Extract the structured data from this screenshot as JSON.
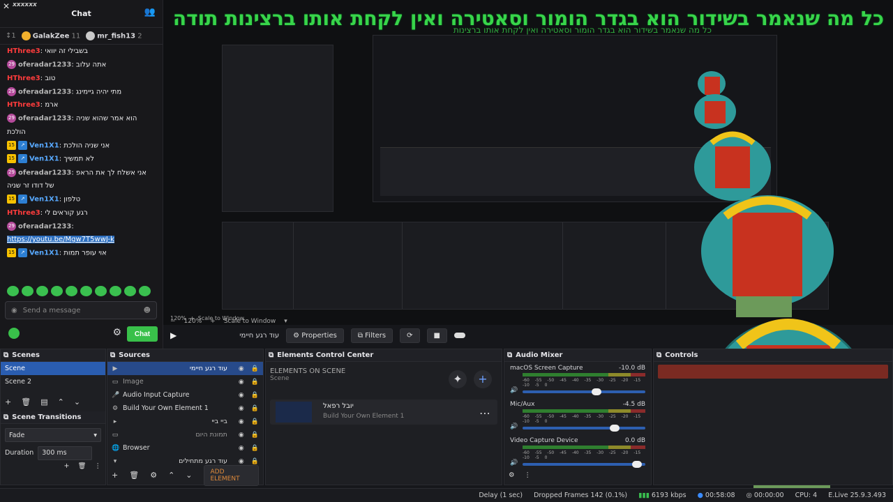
{
  "overlay": {
    "text": "כל מה שנאמר בשידור הוא בגדר הומור וסאטירה ואין לקחת אותו ברצינות תודה",
    "text_small": "כל מה שנאמר בשידור הוא בגדר הומור וסאטירה ואין לקחת אותו ברצינות"
  },
  "chat": {
    "title": "Chat",
    "window_title": "xxxxxx",
    "leader1": {
      "name": "GalakZee",
      "count": "11"
    },
    "leader2": {
      "name": "mr_fish13",
      "count": "2"
    },
    "messages": [
      {
        "badge": "",
        "user": "HThree3",
        "utype": "u1",
        "text": "בשבילי זה יוואי"
      },
      {
        "badge": "29",
        "user": "oferadar1233",
        "utype": "u2",
        "text": "אתה עלוב"
      },
      {
        "badge": "",
        "user": "HThree3",
        "utype": "u1",
        "text": "טוב"
      },
      {
        "badge": "29",
        "user": "oferadar1233",
        "utype": "u2",
        "text": "מתי יהיה גיימינג"
      },
      {
        "badge": "",
        "user": "HThree3",
        "utype": "u1",
        "text": "ארמ"
      },
      {
        "badge": "29",
        "user": "oferadar1233",
        "utype": "u2",
        "text": "הוא אמר שהוא שניה"
      },
      {
        "badge": "",
        "user": "",
        "utype": "u2",
        "text": "הולכת"
      },
      {
        "badge": "15",
        "user": "Ven1X1",
        "utype": "u3",
        "text": "אני שניה הולכת"
      },
      {
        "badge": "15",
        "user": "Ven1X1",
        "utype": "u3",
        "text": "לא תמשיך"
      },
      {
        "badge": "29",
        "user": "oferadar1233",
        "utype": "u2",
        "text": "אני אשלח לך את הראפ"
      },
      {
        "badge": "",
        "user": "",
        "utype": "u2",
        "text": "של דודו זר שניה"
      },
      {
        "badge": "15",
        "user": "Ven1X1",
        "utype": "u3",
        "text": "טלפון"
      },
      {
        "badge": "",
        "user": "HThree3",
        "utype": "u1",
        "text": "רגע קוראים לי"
      },
      {
        "badge": "29",
        "user": "oferadar1233",
        "utype": "u2",
        "text": ""
      },
      {
        "badge": "",
        "user": "",
        "utype": "link",
        "text": "https://youtu.be/Mgw7T5wwJ-k"
      },
      {
        "badge": "15",
        "user": "Ven1X1",
        "utype": "u3",
        "text": "אוי עופר תמות"
      }
    ],
    "send_placeholder": "Send a message",
    "chat_button": "Chat"
  },
  "preview": {
    "zoom": "120%",
    "scale_label": "Scale to Window",
    "scene_name_label": "עוד רגע חיימי",
    "properties": "Properties",
    "filters": "Filters"
  },
  "scenes": {
    "title": "Scenes",
    "items": [
      "Scene",
      "Scene 2"
    ]
  },
  "transitions": {
    "title": "Scene Transitions",
    "type": "Fade",
    "duration_label": "Duration",
    "duration": "300 ms"
  },
  "sources": {
    "title": "Sources",
    "items": [
      {
        "icon": "▶",
        "name": "עוד רגע חיימי",
        "rtl": true,
        "sel": true
      },
      {
        "icon": "▭",
        "name": "Image",
        "rtl": false,
        "dim": true
      },
      {
        "icon": "🎤",
        "name": "Audio Input Capture",
        "rtl": false
      },
      {
        "icon": "⚙",
        "name": "Build Your Own Element 1",
        "rtl": false
      },
      {
        "icon": "▸",
        "name": "ביי ביי",
        "rtl": true
      },
      {
        "icon": "▭",
        "name": "תמונת היום",
        "rtl": true,
        "dim": true
      },
      {
        "icon": "🌐",
        "name": "Browser",
        "rtl": false
      },
      {
        "icon": "▾",
        "name": "עוד רגע מתחילים",
        "rtl": true
      }
    ],
    "add_element": "ADD ELEMENT"
  },
  "elements": {
    "title": "Elements Control Center",
    "subtitle": "ELEMENTS ON SCENE",
    "scene": "Scene",
    "card_name": "יובל רפאל",
    "card_sub": "Build Your Own Element 1"
  },
  "mixer": {
    "title": "Audio Mixer",
    "channels": [
      {
        "name": "macOS Screen Capture",
        "db": "-10.0 dB",
        "level": 0.62
      },
      {
        "name": "Mic/Aux",
        "db": "-4.5 dB",
        "level": 0.77
      },
      {
        "name": "Video Capture Device",
        "db": "0.0 dB",
        "level": 0.95
      }
    ],
    "scale": "-60 -55 -50 -45 -40 -35 -30 -25 -20 -15 -10 -5 0"
  },
  "controls": {
    "title": "Controls"
  },
  "status": {
    "delay": "Delay (1 sec)",
    "dropped": "Dropped Frames 142 (0.1%)",
    "kbps": "6193 kbps",
    "rec_time": "00:58:08",
    "stream_time": "00:00:00",
    "cpu": "CPU: 4",
    "version": "E.Live 25.9.3.493"
  },
  "colors": {
    "accent": "#2a5db0",
    "chat_green": "#39c04a",
    "overlay_green": "#38d54a"
  }
}
